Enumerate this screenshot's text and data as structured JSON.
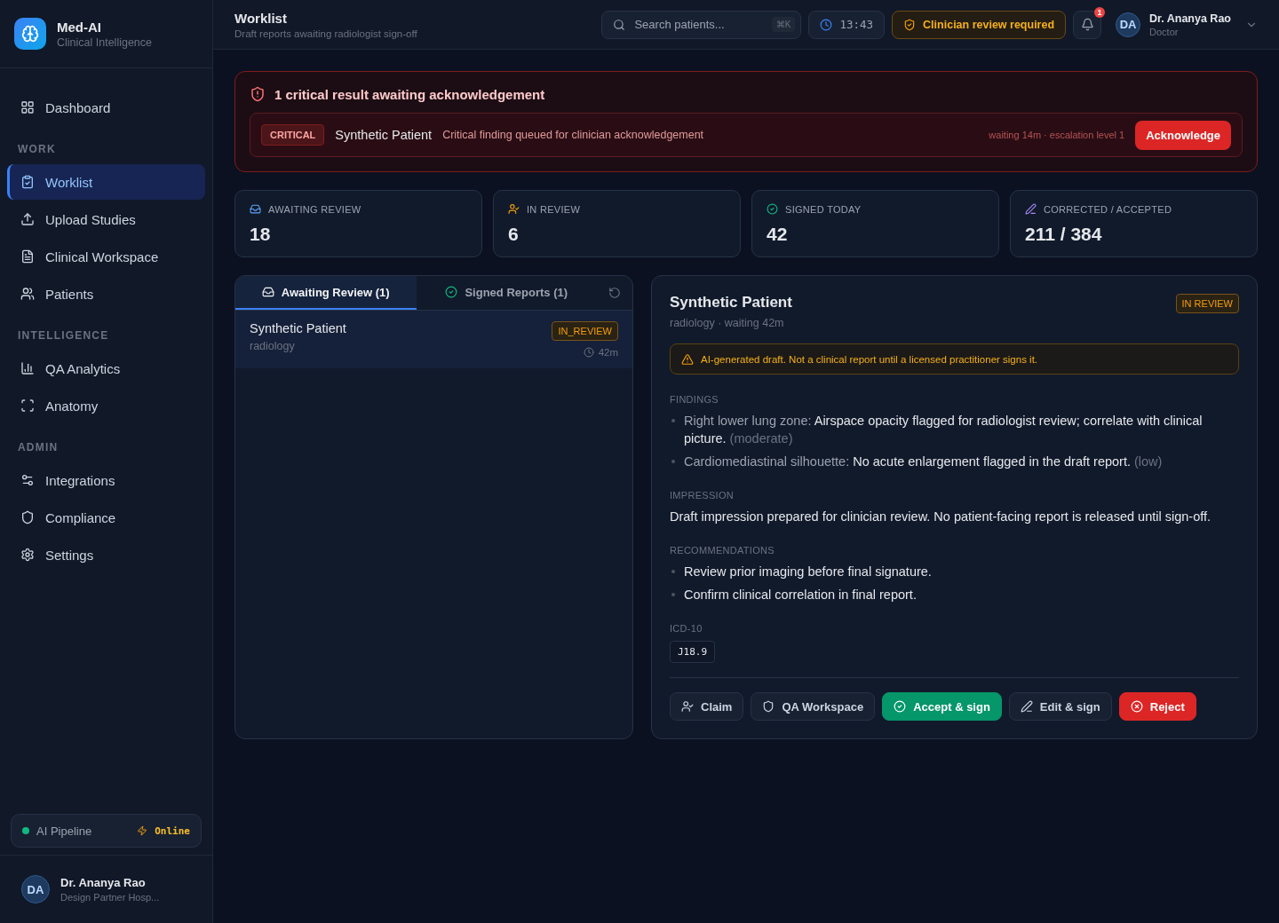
{
  "brand": {
    "name": "Med-AI",
    "subtitle": "Clinical Intelligence"
  },
  "sidebar": {
    "sections": [
      {
        "items": [
          {
            "label": "Dashboard",
            "selected": false
          }
        ]
      },
      {
        "heading": "WORK",
        "items": [
          {
            "label": "Worklist",
            "selected": true
          },
          {
            "label": "Upload Studies",
            "selected": false
          },
          {
            "label": "Clinical Workspace",
            "selected": false
          },
          {
            "label": "Patients",
            "selected": false
          }
        ]
      },
      {
        "heading": "INTELLIGENCE",
        "items": [
          {
            "label": "QA Analytics",
            "selected": false
          },
          {
            "label": "Anatomy",
            "selected": false
          }
        ]
      },
      {
        "heading": "ADMIN",
        "items": [
          {
            "label": "Integrations",
            "selected": false
          },
          {
            "label": "Compliance",
            "selected": false
          },
          {
            "label": "Settings",
            "selected": false
          }
        ]
      }
    ],
    "pipeline": {
      "label": "AI Pipeline",
      "status": "Online",
      "color": "#10b981"
    },
    "user": {
      "initials": "DA",
      "name": "Dr. Ananya Rao",
      "org": "Design Partner Hosp..."
    }
  },
  "header": {
    "title": "Worklist",
    "subtitle": "Draft reports awaiting radiologist sign-off",
    "search": {
      "placeholder": "Search patients...",
      "shortcut": "⌘K"
    },
    "time": "13:43",
    "review_badge": "Clinician review required",
    "notifications": "1",
    "user": {
      "initials": "DA",
      "name": "Dr. Ananya Rao",
      "role": "Doctor"
    }
  },
  "alert": {
    "title": "1 critical result awaiting acknowledgement",
    "items": [
      {
        "tag": "CRITICAL",
        "patient": "Synthetic Patient",
        "message": "Critical finding queued for clinician acknowledgement",
        "meta": "waiting 14m · escalation level 1",
        "action": "Acknowledge"
      }
    ]
  },
  "stats": [
    {
      "label": "AWAITING REVIEW",
      "value": "18"
    },
    {
      "label": "IN REVIEW",
      "value": "6"
    },
    {
      "label": "SIGNED TODAY",
      "value": "42"
    },
    {
      "label": "CORRECTED / ACCEPTED",
      "value": "211 / 384"
    }
  ],
  "worklist": {
    "tabs": [
      {
        "label": "Awaiting Review (1)",
        "selected": true
      },
      {
        "label": "Signed Reports (1)",
        "selected": false
      }
    ],
    "rows": [
      {
        "name": "Synthetic Patient",
        "department": "radiology",
        "status": "IN_REVIEW",
        "waiting": "42m",
        "selected": true
      }
    ]
  },
  "detail": {
    "name": "Synthetic Patient",
    "meta": "radiology · waiting 42m",
    "status": "IN REVIEW",
    "warning": "AI-generated draft. Not a clinical report until a licensed practitioner signs it.",
    "findings_heading": "FINDINGS",
    "findings": [
      {
        "region": "Right lower lung zone:",
        "text": "Airspace opacity flagged for radiologist review; correlate with clinical picture.",
        "severity": "(moderate)"
      },
      {
        "region": "Cardiomediastinal silhouette:",
        "text": "No acute enlargement flagged in the draft report.",
        "severity": "(low)"
      }
    ],
    "impression_heading": "IMPRESSION",
    "impression": "Draft impression prepared for clinician review. No patient-facing report is released until sign-off.",
    "recommendations_heading": "RECOMMENDATIONS",
    "recommendations": [
      "Review prior imaging before final signature.",
      "Confirm clinical correlation in final report."
    ],
    "icd_heading": "ICD-10",
    "icd_codes": [
      "J18.9"
    ],
    "actions": [
      {
        "label": "Claim",
        "kind": "default"
      },
      {
        "label": "QA Workspace",
        "kind": "default"
      },
      {
        "label": "Accept & sign",
        "kind": "success"
      },
      {
        "label": "Edit & sign",
        "kind": "default"
      },
      {
        "label": "Reject",
        "kind": "danger"
      }
    ]
  }
}
